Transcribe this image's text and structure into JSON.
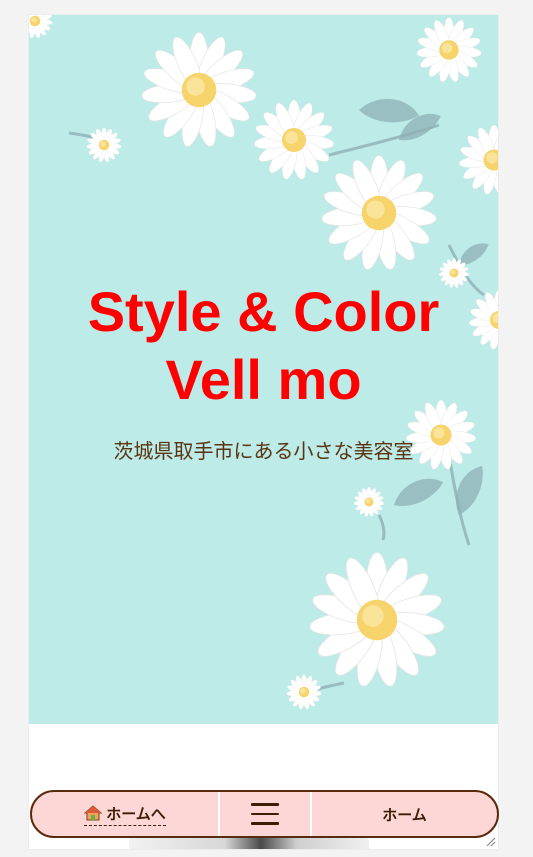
{
  "hero": {
    "title_line1": "Style & Color",
    "title_line2": "Vell mo",
    "subtitle": "茨城県取手市にある小さな美容室"
  },
  "colors": {
    "hero_bg": "#bdebe7",
    "title": "#ff0000",
    "subtitle": "#5a3412",
    "nav_bg": "#fcd7d5",
    "nav_border": "#5a2a0c"
  },
  "bottom_nav": {
    "home_link_label": "ホームへ",
    "home_icon": "house-icon",
    "menu_icon": "hamburger-menu-icon",
    "right_label": "ホーム"
  }
}
